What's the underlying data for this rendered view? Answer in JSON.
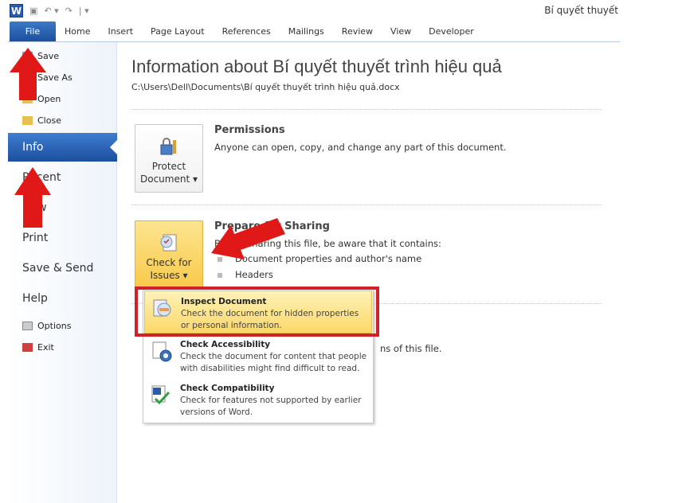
{
  "window": {
    "title": "Bí quyết thuyết"
  },
  "qat": {
    "app_icon": "W"
  },
  "tabs": [
    "File",
    "Home",
    "Insert",
    "Page Layout",
    "References",
    "Mailings",
    "Review",
    "View",
    "Developer"
  ],
  "left_nav": {
    "small_top": [
      "Save",
      "Save As",
      "Open",
      "Close"
    ],
    "info": "Info",
    "big": [
      "Recent",
      "New",
      "Print",
      "Save & Send",
      "Help"
    ],
    "small_bottom": [
      "Options",
      "Exit"
    ]
  },
  "main": {
    "heading": "Information about Bí quyết thuyết trình hiệu quả",
    "path": "C:\\Users\\Dell\\Documents\\Bí quyết thuyết trình hiệu quả.docx",
    "permissions": {
      "button": [
        "Protect",
        "Document ▾"
      ],
      "title": "Permissions",
      "text": "Anyone can open, copy, and change any part of this document."
    },
    "sharing": {
      "button": [
        "Check for",
        "Issues ▾"
      ],
      "title": "Prepare for Sharing",
      "text": "Before sharing this file, be aware that it contains:",
      "bullets": [
        "Document properties and author's name",
        "Headers"
      ]
    },
    "versions": {
      "text": "ns of this file."
    }
  },
  "menu": [
    {
      "title": "Inspect Document",
      "desc": [
        "Check the document for hidden properties",
        "or personal information."
      ],
      "icon": "inspect-icon"
    },
    {
      "title": "Check Accessibility",
      "desc": [
        "Check the document for content that people",
        "with disabilities might find difficult to read."
      ],
      "icon": "accessibility-icon"
    },
    {
      "title": "Check Compatibility",
      "desc": [
        "Check for features not supported by earlier",
        "versions of Word."
      ],
      "icon": "compatibility-icon"
    }
  ],
  "colors": {
    "file_tab": "#2a62b8",
    "highlight": "#d0202a",
    "arrow": "#e01818",
    "selected": "#fbd868"
  }
}
